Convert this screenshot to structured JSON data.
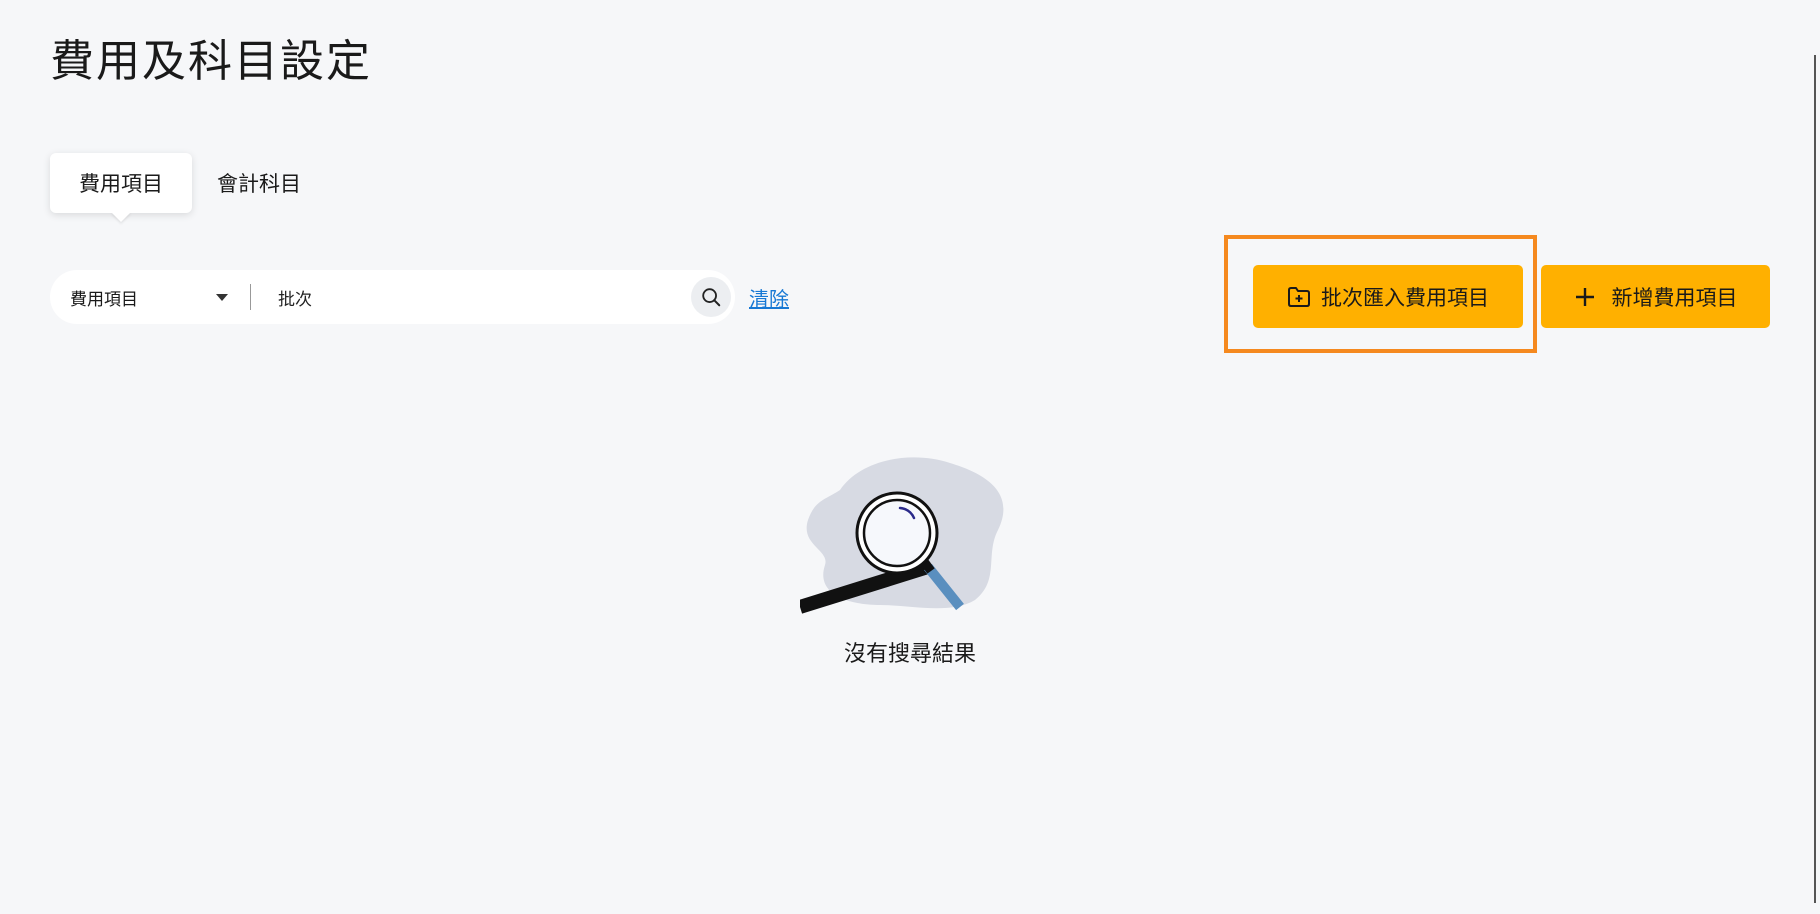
{
  "page": {
    "title": "費用及科目設定"
  },
  "tabs": [
    {
      "label": "費用項目",
      "active": true
    },
    {
      "label": "會計科目",
      "active": false
    }
  ],
  "search": {
    "field_selected": "費用項目",
    "query_value": "批次",
    "clear_label": "清除",
    "icon": "search-icon"
  },
  "actions": {
    "import_label": "批次匯入費用項目",
    "import_icon": "folder-plus-icon",
    "add_label": "新增費用項目",
    "add_icon": "plus-icon"
  },
  "empty_state": {
    "message": "沒有搜尋結果",
    "icon": "magnifier-illustration"
  },
  "colors": {
    "accent_button": "#ffb000",
    "highlight_border": "#f5891f",
    "link": "#1778d4",
    "background": "#f6f7f9"
  }
}
